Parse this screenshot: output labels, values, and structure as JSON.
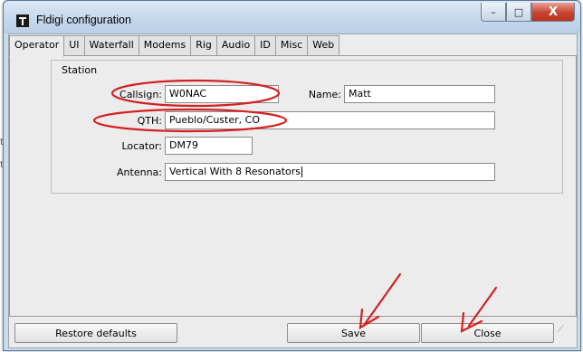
{
  "window": {
    "title": "Fldigi configuration",
    "controls": {
      "minimize": "–",
      "maximize": "□",
      "close": "X"
    }
  },
  "tabs": [
    {
      "label": "Operator",
      "active": true
    },
    {
      "label": "UI"
    },
    {
      "label": "Waterfall"
    },
    {
      "label": "Modems"
    },
    {
      "label": "Rig"
    },
    {
      "label": "Audio"
    },
    {
      "label": "ID"
    },
    {
      "label": "Misc"
    },
    {
      "label": "Web"
    }
  ],
  "station": {
    "group_label": "Station",
    "callsign": {
      "label": "Callsign:",
      "value": "W0NAC"
    },
    "name": {
      "label": "Name:",
      "value": "Matt"
    },
    "qth": {
      "label": "QTH:",
      "value": "Pueblo/Custer, CO"
    },
    "locator": {
      "label": "Locator:",
      "value": "DM79"
    },
    "antenna": {
      "label": "Antenna:",
      "value": "Vertical With 8 Resonators"
    }
  },
  "buttons": {
    "restore_defaults": "Restore defaults",
    "save": "Save",
    "close": "Close"
  },
  "annotations": {
    "color": "#d42020"
  },
  "side_stubs": [
    "t",
    "t"
  ]
}
